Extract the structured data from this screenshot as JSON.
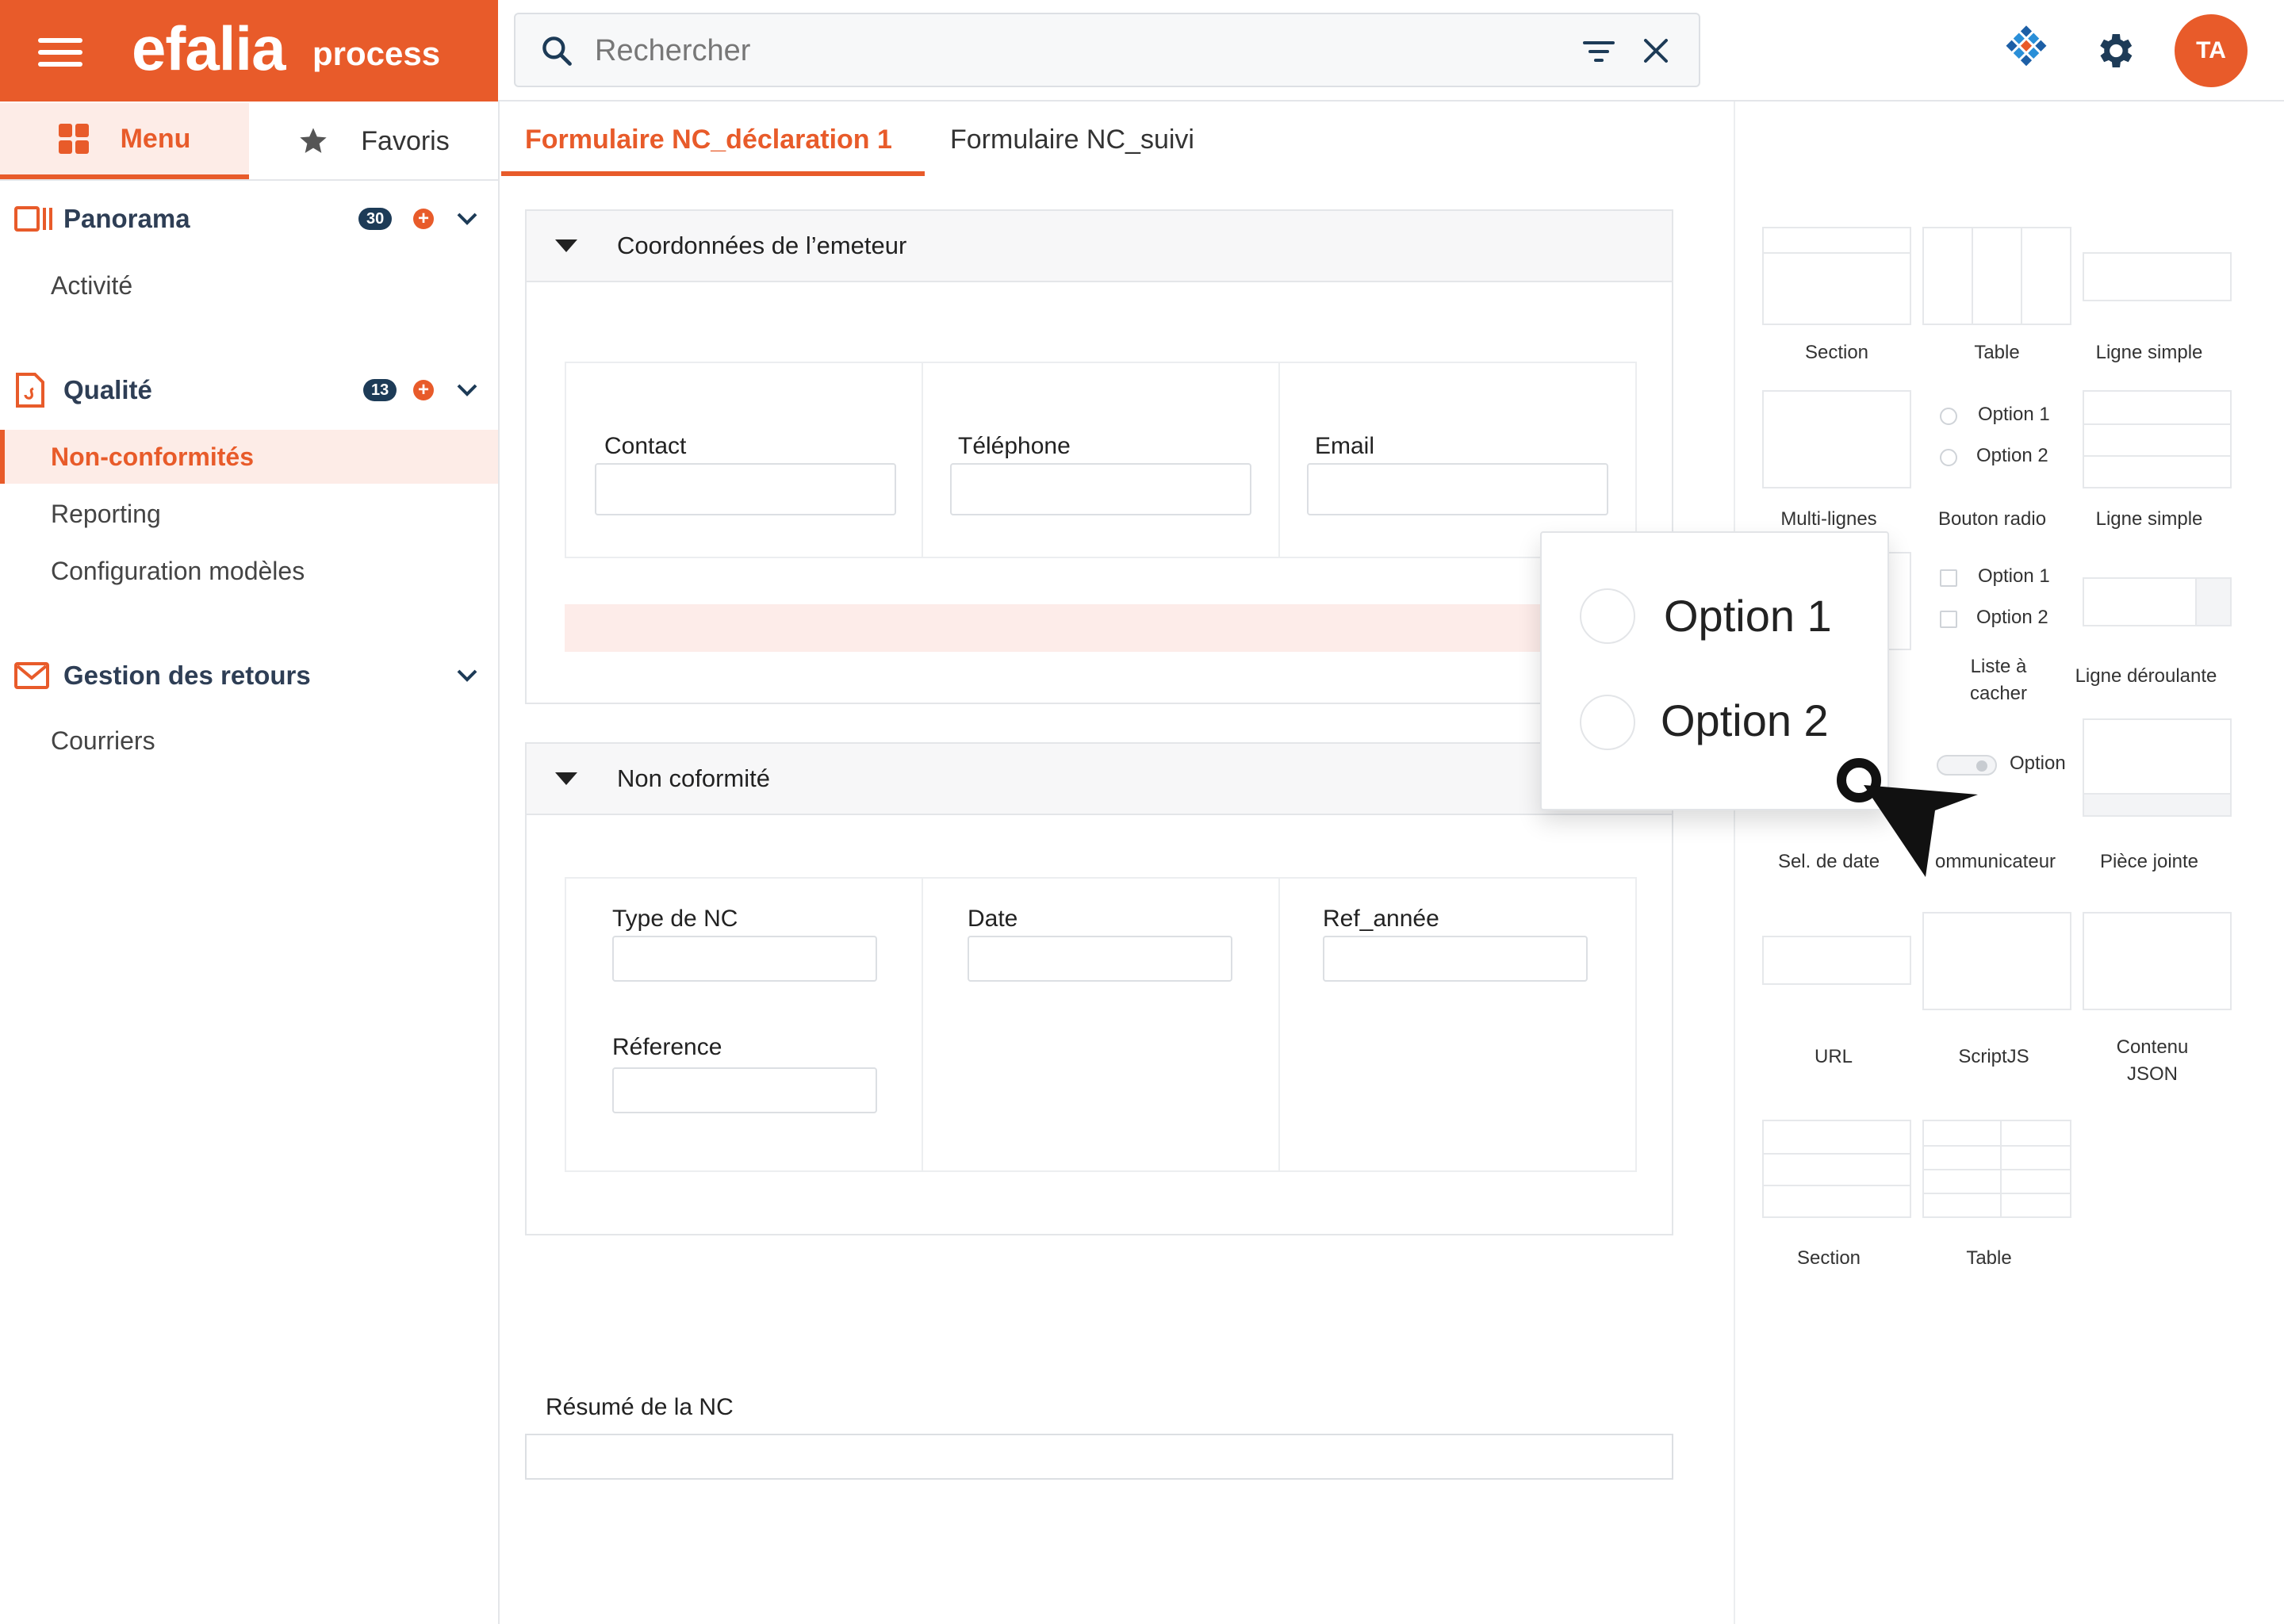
{
  "brand": {
    "logo": "efalia",
    "logo_sub": "process"
  },
  "search": {
    "placeholder": "Rechercher"
  },
  "user": {
    "initials": "TA"
  },
  "sidebar": {
    "tabs": [
      {
        "label": "Menu"
      },
      {
        "label": "Favoris"
      }
    ],
    "sections": [
      {
        "title": "Panorama",
        "count": "30",
        "items": [
          "Activité"
        ]
      },
      {
        "title": "Qualité",
        "count": "13",
        "items": [
          "Non-conformités",
          "Reporting",
          "Configuration modèles"
        ]
      },
      {
        "title": "Gestion des retours",
        "items": [
          "Courriers"
        ]
      }
    ]
  },
  "form_tabs": [
    {
      "label": "Formulaire NC_déclaration 1"
    },
    {
      "label": "Formulaire  NC_suivi"
    }
  ],
  "form": {
    "section1": {
      "title": "Coordonnées de l’emeteur",
      "fields": [
        "Contact",
        "Téléphone",
        "Email"
      ]
    },
    "section2": {
      "title": "Non coformité",
      "fields": [
        "Type de NC",
        "Date",
        "Ref_année",
        "Réference"
      ]
    },
    "summary_label": "Résumé de la NC"
  },
  "palette": {
    "items": [
      {
        "label": "Section"
      },
      {
        "label": "Table"
      },
      {
        "label": "Ligne simple"
      },
      {
        "label": "Multi-lignes"
      },
      {
        "label": "Bouton radio"
      },
      {
        "label": "Ligne simple"
      },
      {
        "label": "Liste à cacher"
      },
      {
        "label": "Ligne déroulante"
      },
      {
        "label": "Sel. de date"
      },
      {
        "label": "ommunicateur"
      },
      {
        "label": "Pièce jointe"
      },
      {
        "label": "URL"
      },
      {
        "label": "ScriptJS"
      },
      {
        "label": "Contenu JSON"
      },
      {
        "label": "Section"
      },
      {
        "label": "Table"
      }
    ],
    "radio_options": [
      "Option 1",
      "Option 2"
    ],
    "check_options": [
      "Option 1",
      "Option 2"
    ],
    "toggle_option": "Option"
  },
  "drag_preview": {
    "options": [
      "Option 1",
      "Option 2"
    ]
  },
  "colors": {
    "accent": "#e85b2a",
    "navy": "#1d3b57",
    "pink": "#fdecE9"
  }
}
